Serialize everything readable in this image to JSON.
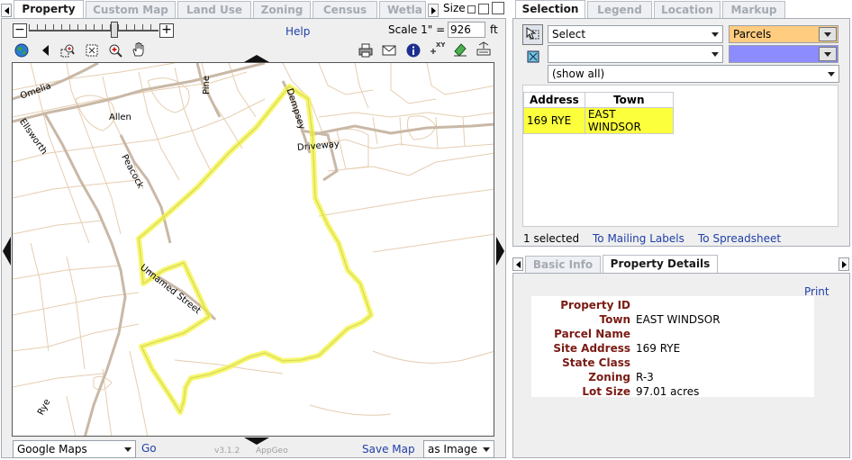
{
  "left_tabs": [
    "Property",
    "Custom Map",
    "Land Use",
    "Zoning",
    "Census",
    "Wetla"
  ],
  "size_label": "Size",
  "help_link": "Help",
  "scale": {
    "label": "Scale 1\" =",
    "value": "926",
    "unit": "ft"
  },
  "map_labels": {
    "omelia": "Omelia",
    "ellsworth": "Ellsworth",
    "allen": "Allen",
    "pine": "Pine",
    "dempsey": "Dempsey",
    "driveway": "Driveway",
    "peacock": "Peacock",
    "unnamed": "Unnamed Street",
    "rye": "Rye"
  },
  "bottom_bar": {
    "basemap": "Google Maps",
    "go": "Go",
    "version": "v3.1.2",
    "brand": "AppGeo",
    "save_map": "Save Map",
    "as_image": "as Image"
  },
  "right_tabs": [
    "Selection",
    "Legend",
    "Location",
    "Markup"
  ],
  "selection": {
    "action": "Select",
    "layer": "Parcels",
    "second_select": "",
    "filter": "(show all)",
    "columns": [
      "Address",
      "Town"
    ],
    "rows": [
      [
        "169 RYE",
        "EAST WINDSOR"
      ]
    ],
    "count": "1 selected",
    "mailing": "To Mailing Labels",
    "spreadsheet": "To Spreadsheet"
  },
  "detail_tabs": [
    "Basic Info",
    "Property Details"
  ],
  "print_link": "Print",
  "property": [
    {
      "k": "Property ID",
      "v": ""
    },
    {
      "k": "Town",
      "v": "EAST WINDSOR"
    },
    {
      "k": "Parcel Name",
      "v": ""
    },
    {
      "k": "Site Address",
      "v": "169 RYE"
    },
    {
      "k": "State Class",
      "v": ""
    },
    {
      "k": "Zoning",
      "v": "R-3"
    },
    {
      "k": "Lot Size",
      "v": "97.01 acres"
    }
  ],
  "colors": {
    "accent_link": "#1f3fa8",
    "highlight": "#fbff3c",
    "layer_orange": "#ffcc80",
    "fill_blue": "#8c8cff",
    "label_red": "#7a1b14"
  }
}
